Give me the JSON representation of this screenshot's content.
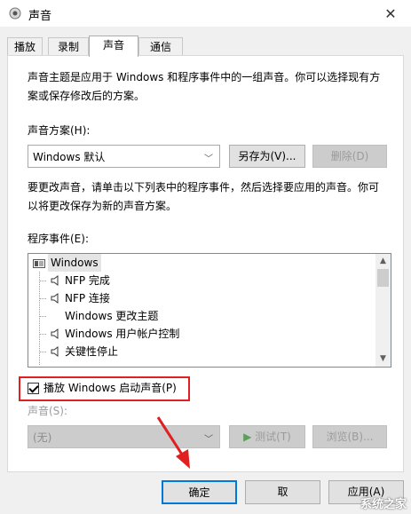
{
  "window": {
    "title": "声音",
    "close_icon": "close-icon"
  },
  "tabs": [
    {
      "label": "播放"
    },
    {
      "label": "录制"
    },
    {
      "label": "声音"
    },
    {
      "label": "通信"
    }
  ],
  "intro_line1": "声音主题是应用于 Windows 和程序事件中的一组声音。你可以选择现有方",
  "intro_line2": "案或保存修改后的方案。",
  "scheme": {
    "label": "声音方案(H):",
    "value": "Windows 默认",
    "save_as": "另存为(V)...",
    "delete": "删除(D)"
  },
  "instructions_line1": "要更改声音，请单击以下列表中的程序事件，然后选择要应用的声音。你可",
  "instructions_line2": "以将更改保存为新的声音方案。",
  "events": {
    "label": "程序事件(E):",
    "root": "Windows",
    "items": [
      {
        "label": "NFP 完成",
        "has_sound": true
      },
      {
        "label": "NFP 连接",
        "has_sound": true
      },
      {
        "label": "Windows 更改主题",
        "has_sound": false
      },
      {
        "label": "Windows 用户帐户控制",
        "has_sound": true
      },
      {
        "label": "关键性停止",
        "has_sound": true
      }
    ]
  },
  "startup_sound": {
    "label": "播放 Windows 启动声音(P)",
    "checked": true
  },
  "sound": {
    "label": "声音(S):",
    "value": "(无)",
    "test": "测试(T)",
    "browse": "浏览(B)..."
  },
  "footer": {
    "ok": "确定",
    "cancel": "取",
    "apply": "应用(A)"
  },
  "watermark": "系统之家",
  "colors": {
    "highlight": "#e02020"
  }
}
